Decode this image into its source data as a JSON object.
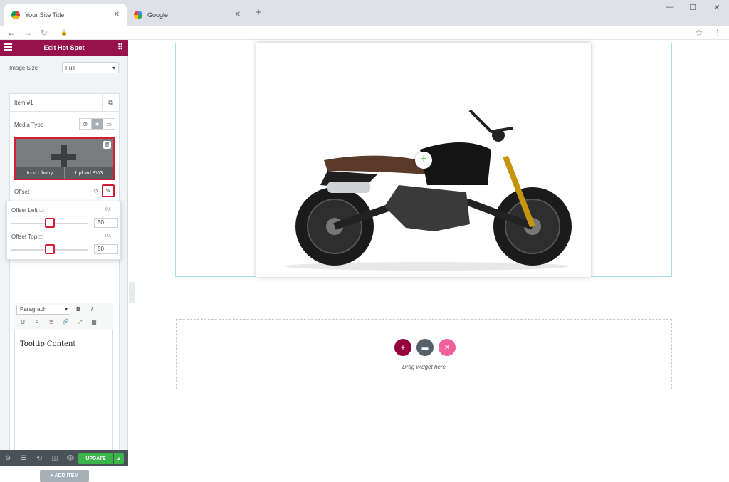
{
  "browser": {
    "tabs": [
      {
        "title": "Your Site Title",
        "close": "✕"
      },
      {
        "title": "Google",
        "close": "✕"
      }
    ],
    "new_tab": "+",
    "window_controls": {
      "minimize": "—",
      "maximize": "☐",
      "close": "✕"
    },
    "nav": {
      "back": "←",
      "forward": "→",
      "reload": "↻",
      "lock": "🔒",
      "star": "☆",
      "menu": "⋮"
    }
  },
  "panel": {
    "title": "Edit Hot Spot",
    "image_size": {
      "label": "Image Size",
      "value": "Full"
    },
    "item": {
      "label": "Item #1"
    },
    "media_type": {
      "label": "Media Type",
      "options": [
        "⊘",
        "★",
        "▭"
      ],
      "selected_index": 1
    },
    "icon_picker": {
      "left": "Icon Library",
      "right": "Upload SVG",
      "trash": "🗑"
    },
    "offset": {
      "label": "Offset",
      "reset": "↺",
      "edit": "✎"
    },
    "offset_left": {
      "label": "Offset Left",
      "unit": "PX",
      "value": "50",
      "slider": 0.5
    },
    "offset_top": {
      "label": "Offset Top",
      "unit": "PX",
      "value": "50",
      "slider": 0.5
    },
    "editor": {
      "format": "Paragraph",
      "bold": "B",
      "italic": "I",
      "underline": "U",
      "list_bullets": "≡",
      "list_numbers": "≣",
      "link": "🔗",
      "fullscreen": "⤢",
      "kitchen": "▦",
      "content": "Tooltip Content"
    },
    "add_item": "+ ADD ITEM"
  },
  "footer": {
    "icons": [
      "⚙",
      "☰",
      "⟲",
      "◫",
      "👁"
    ],
    "update": "UPDATE",
    "update_arrow": "▲"
  },
  "canvas": {
    "hotspot": "+",
    "drop_text": "Drag widget here",
    "drop_buttons": [
      {
        "icon": "+",
        "color": "#93003c"
      },
      {
        "icon": "▬",
        "color": "#556068"
      },
      {
        "icon": "✕",
        "color": "#f0609d"
      }
    ]
  },
  "colors": {
    "brand": "#97124a",
    "highlight": "#d31f35",
    "update": "#39b54a"
  }
}
